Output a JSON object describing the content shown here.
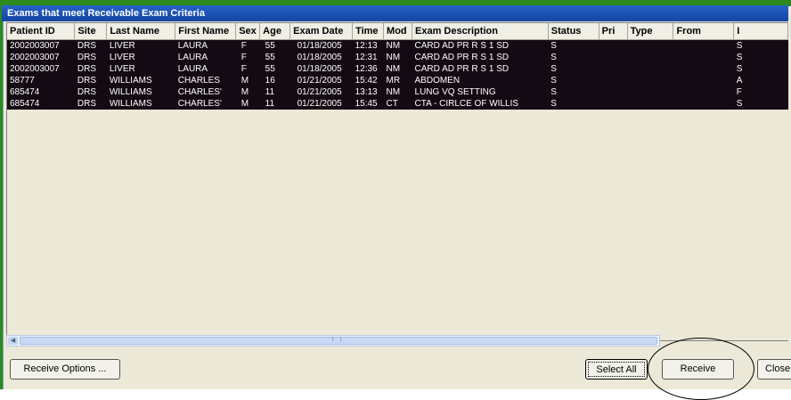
{
  "window": {
    "title": "Exams that meet Receivable Exam Criteria"
  },
  "columns": [
    "Patient ID",
    "Site",
    "Last Name",
    "First Name",
    "Sex",
    "Age",
    "Exam Date",
    "Time",
    "Mod",
    "Exam Description",
    "Status",
    "Pri",
    "Type",
    "From",
    "I"
  ],
  "rows": [
    [
      "2002003007",
      "DRS",
      "LIVER",
      "LAURA",
      "F",
      "55",
      "01/18/2005",
      "12:13",
      "NM",
      "CARD AD PR R S 1 SD",
      "S",
      "",
      "",
      "",
      "S"
    ],
    [
      "2002003007",
      "DRS",
      "LIVER",
      "LAURA",
      "F",
      "55",
      "01/18/2005",
      "12:31",
      "NM",
      "CARD AD PR R S 1 SD",
      "S",
      "",
      "",
      "",
      "S"
    ],
    [
      "2002003007",
      "DRS",
      "LIVER",
      "LAURA",
      "F",
      "55",
      "01/18/2005",
      "12:36",
      "NM",
      "CARD AD PR R S 1 SD",
      "S",
      "",
      "",
      "",
      "S"
    ],
    [
      "58777",
      "DRS",
      "WILLIAMS",
      "CHARLES",
      "M",
      "16",
      "01/21/2005",
      "15:42",
      "MR",
      "ABDOMEN",
      "S",
      "",
      "",
      "",
      "A"
    ],
    [
      "685474",
      "DRS",
      "WILLIAMS",
      "CHARLES'",
      "M",
      "11",
      "01/21/2005",
      "13:13",
      "NM",
      "LUNG VQ SETTING",
      "S",
      "",
      "",
      "",
      "F"
    ],
    [
      "685474",
      "DRS",
      "WILLIAMS",
      "CHARLES'",
      "M",
      "11",
      "01/21/2005",
      "15:45",
      "CT",
      "CTA - CIRLCE OF WILLIS",
      "S",
      "",
      "",
      "",
      "S"
    ]
  ],
  "buttons": {
    "receive_options": "Receive Options ...",
    "select_all": "Select All",
    "receive": "Receive",
    "close": "Close"
  },
  "colors": {
    "row_bg": "#140a14",
    "title_bg": "#1a4fb0",
    "frame_green": "#2a8a1e"
  }
}
